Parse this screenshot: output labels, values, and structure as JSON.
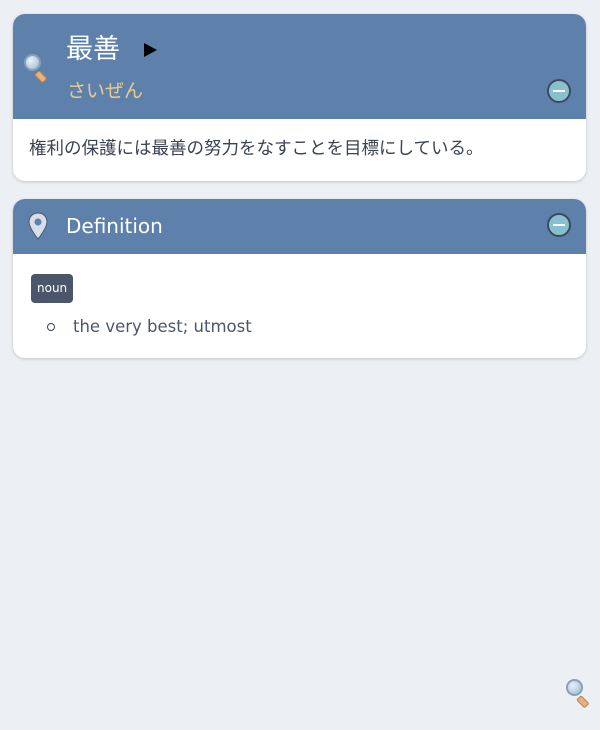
{
  "word_card": {
    "headword": "最善",
    "reading": "さいぜん",
    "example_sentence": "権利の保護には最善の努力をなすことを目標にしている。",
    "icons": {
      "lookup": "magnifier-icon",
      "play": "play-icon",
      "collapse": "minus-circle-icon"
    }
  },
  "definition_card": {
    "title": "Definition",
    "part_of_speech": "noun",
    "glosses": [
      "the very best; utmost"
    ],
    "icons": {
      "section": "map-pin-icon",
      "collapse": "minus-circle-icon"
    }
  },
  "footer": {
    "icon": "magnifier-icon"
  },
  "colors": {
    "background": "#eceff4",
    "header": "#5e81ac",
    "reading": "#ebcb8b",
    "badge": "#4c566a",
    "collapse_button": "#88c0d0"
  }
}
